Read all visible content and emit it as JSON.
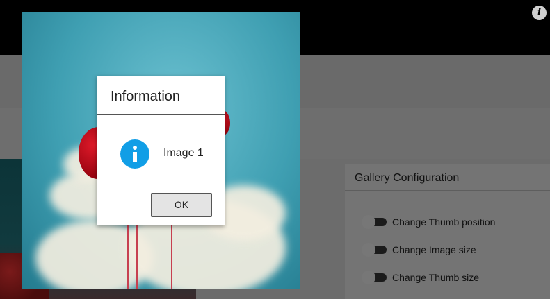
{
  "header": {
    "info_icon_glyph": "i"
  },
  "config": {
    "title": "Gallery Configuration",
    "options": [
      {
        "label": "Change Thumb position",
        "enabled": false
      },
      {
        "label": "Change Image size",
        "enabled": false
      },
      {
        "label": "Change Thumb size",
        "enabled": false
      }
    ]
  },
  "lightbox": {
    "image": "balloons-in-sky"
  },
  "dialog": {
    "title": "Information",
    "message": "Image 1",
    "ok_label": "OK",
    "icon": "info-icon",
    "icon_color": "#119ee6"
  }
}
